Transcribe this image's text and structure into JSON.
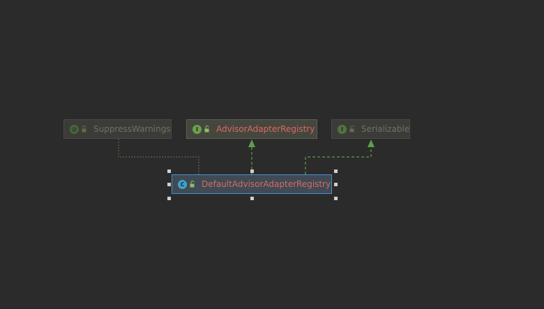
{
  "diagram": {
    "nodes": [
      {
        "id": "suppress",
        "label": "SuppressWarnings",
        "kind": "annotation",
        "badge": "@",
        "icon": "annotation-icon",
        "faded": true
      },
      {
        "id": "registry",
        "label": "AdvisorAdapterRegistry",
        "kind": "interface",
        "badge": "I",
        "icon": "interface-icon",
        "faded": false
      },
      {
        "id": "serializable",
        "label": "Serializable",
        "kind": "interface",
        "badge": "I",
        "icon": "interface-icon",
        "faded": true
      },
      {
        "id": "default",
        "label": "DefaultAdvisorAdapterRegistry",
        "kind": "class",
        "badge": "C",
        "icon": "class-icon",
        "faded": false,
        "selected": true
      }
    ],
    "edges": [
      {
        "from": "default",
        "to": "suppress",
        "type": "annotated-by",
        "style": "dotted"
      },
      {
        "from": "default",
        "to": "registry",
        "type": "implements",
        "style": "dashed-arrow"
      },
      {
        "from": "default",
        "to": "serializable",
        "type": "implements",
        "style": "dashed-arrow"
      }
    ],
    "colors": {
      "background": "#2b2b2b",
      "label": "#d96a5d",
      "muted_label": "#9a9a92",
      "implements_edge": "#5f9e4a",
      "selection_border": "#4d8ec9"
    }
  }
}
